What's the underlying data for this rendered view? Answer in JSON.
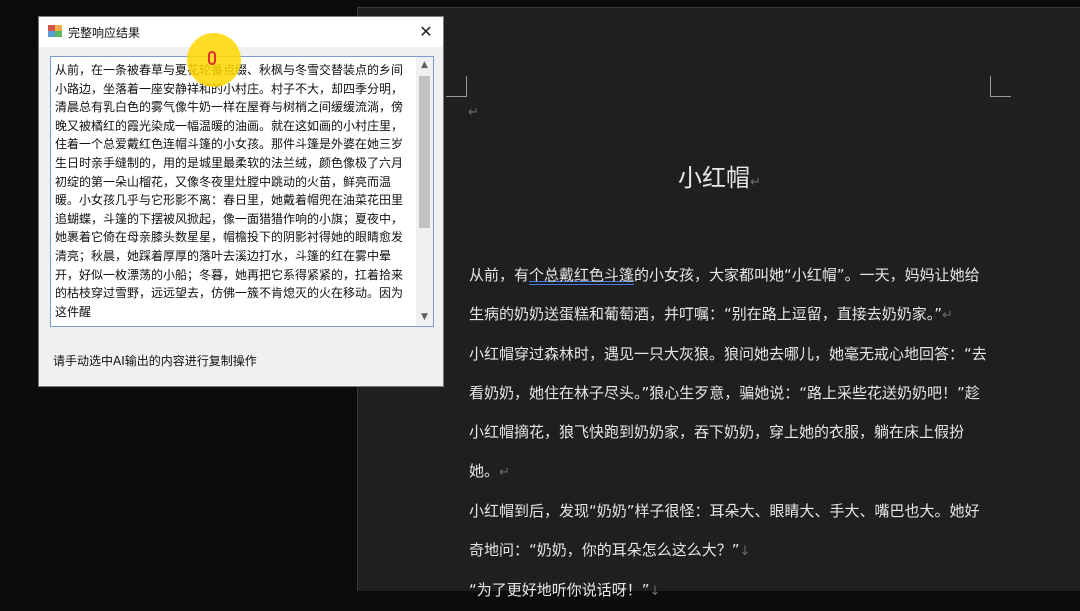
{
  "dialog": {
    "title": "完整响应结果",
    "close_icon": "close-icon",
    "text": "从前，在一条被春草与夏花轮番点缀、秋枫与冬雪交替装点的乡间小路边，坐落着一座安静祥和的小村庄。村子不大，却四季分明，清晨总有乳白色的雾气像牛奶一样在屋脊与树梢之间缓缓流淌，傍晚又被橘红的霞光染成一幅温暖的油画。就在这如画的小村庄里，住着一个总爱戴红色连帽斗篷的小女孩。那件斗篷是外婆在她三岁生日时亲手缝制的，用的是城里最柔软的法兰绒，颜色像极了六月初绽的第一朵山榴花，又像冬夜里灶膛中跳动的火苗，鲜亮而温暖。小女孩几乎与它形影不离：春日里，她戴着帽兜在油菜花田里追蝴蝶，斗篷的下摆被风掀起，像一面猎猎作响的小旗；夏夜中，她裹着它倚在母亲膝头数星星，帽檐投下的阴影衬得她的眼睛愈发清亮；秋晨，她踩着厚厚的落叶去溪边打水，斗篷的红在雾中晕开，好似一枚漂荡的小船；冬暮，她再把它系得紧紧的，扛着拾来的枯枝穿过雪野，远远望去，仿佛一簇不肯熄灭的火在移动。因为这件醒",
    "hint": "请手动选中AI输出的内容进行复制操作"
  },
  "document": {
    "title": "小红帽",
    "paragraphs": [
      {
        "pre": "从前，有",
        "u": "个总戴红色斗篷",
        "post": "的小女孩，大家都叫她“小红帽”。一天，妈妈让她给生病的奶奶送蛋糕和葡萄酒，并叮嘱：“别在路上逗留，直接去奶奶家。”"
      },
      {
        "pre": "小红帽穿过森林时，遇见一只大灰狼。狼问她去哪儿，她毫无戒心地回答：“去看奶奶，她住在林子尽头。”狼心生歹意，骗她说：“路上采些花送奶奶吧！”趁小红帽摘花，狼飞快跑到奶奶家，吞下奶奶，穿上她的衣服，躺在床上假扮她。",
        "u": "",
        "post": ""
      },
      {
        "pre": "小红帽到后，发现“奶奶”样子很怪：耳朵大、眼睛大、手大、嘴巴也大。她好奇地问：“奶奶，你的耳朵怎么这么大？”",
        "u": "",
        "post": ""
      },
      {
        "pre": "“为了更好地听你说话呀！”",
        "u": "",
        "post": ""
      }
    ],
    "paragraph_mark": "↵",
    "line_break_mark": "↓"
  }
}
